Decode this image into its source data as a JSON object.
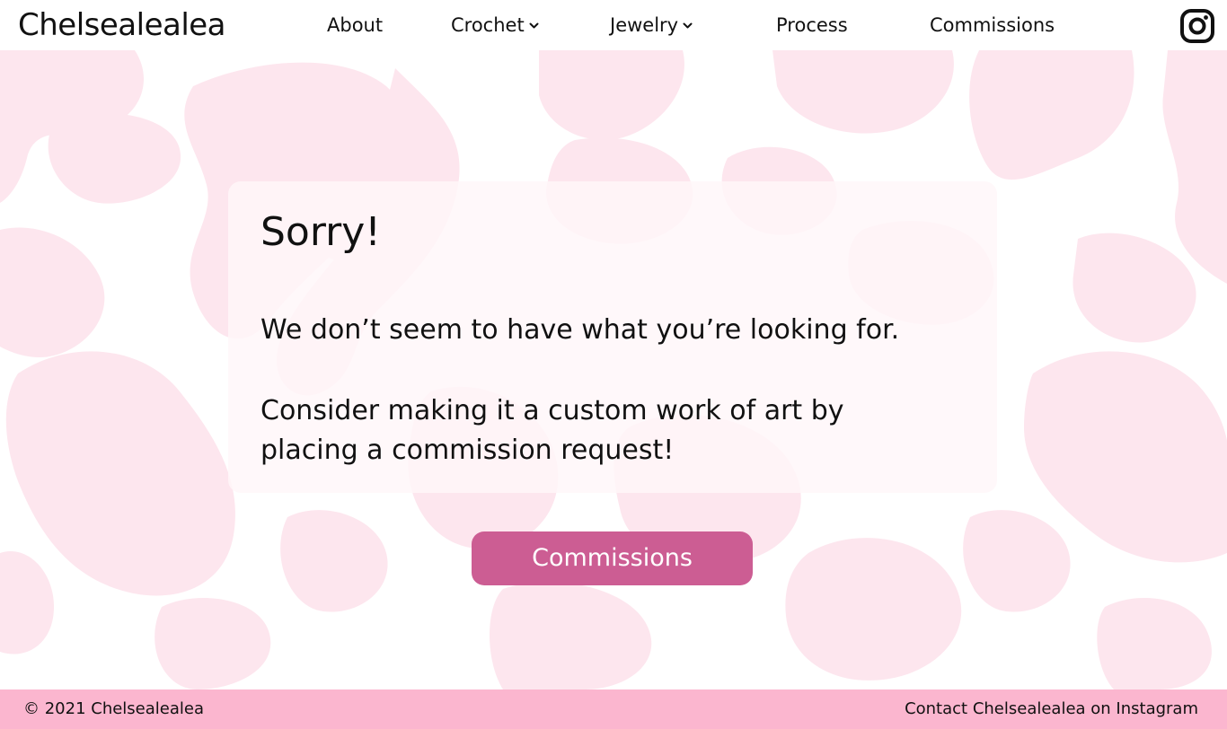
{
  "colors": {
    "background": "#ffffff",
    "blob_pink": "#fde6ee",
    "button": "#cc5d93",
    "footer": "#fbb6cf",
    "text": "#111111"
  },
  "header": {
    "brand": "Chelsealealea",
    "nav": [
      {
        "label": "About",
        "has_dropdown": false
      },
      {
        "label": "Crochet",
        "has_dropdown": true
      },
      {
        "label": "Jewelry",
        "has_dropdown": true
      },
      {
        "label": "Process",
        "has_dropdown": false
      },
      {
        "label": "Commissions",
        "has_dropdown": false
      }
    ],
    "social_icon": "instagram-icon"
  },
  "main": {
    "heading": "Sorry!",
    "message_line": "We don’t seem to have what you’re looking for.",
    "suggestion": "Consider making it a custom work of art by placing a commission request!",
    "button_label": "Commissions"
  },
  "footer": {
    "copyright": "© 2021 Chelsealealea",
    "contact_link": "Contact Chelsealealea on Instagram"
  }
}
